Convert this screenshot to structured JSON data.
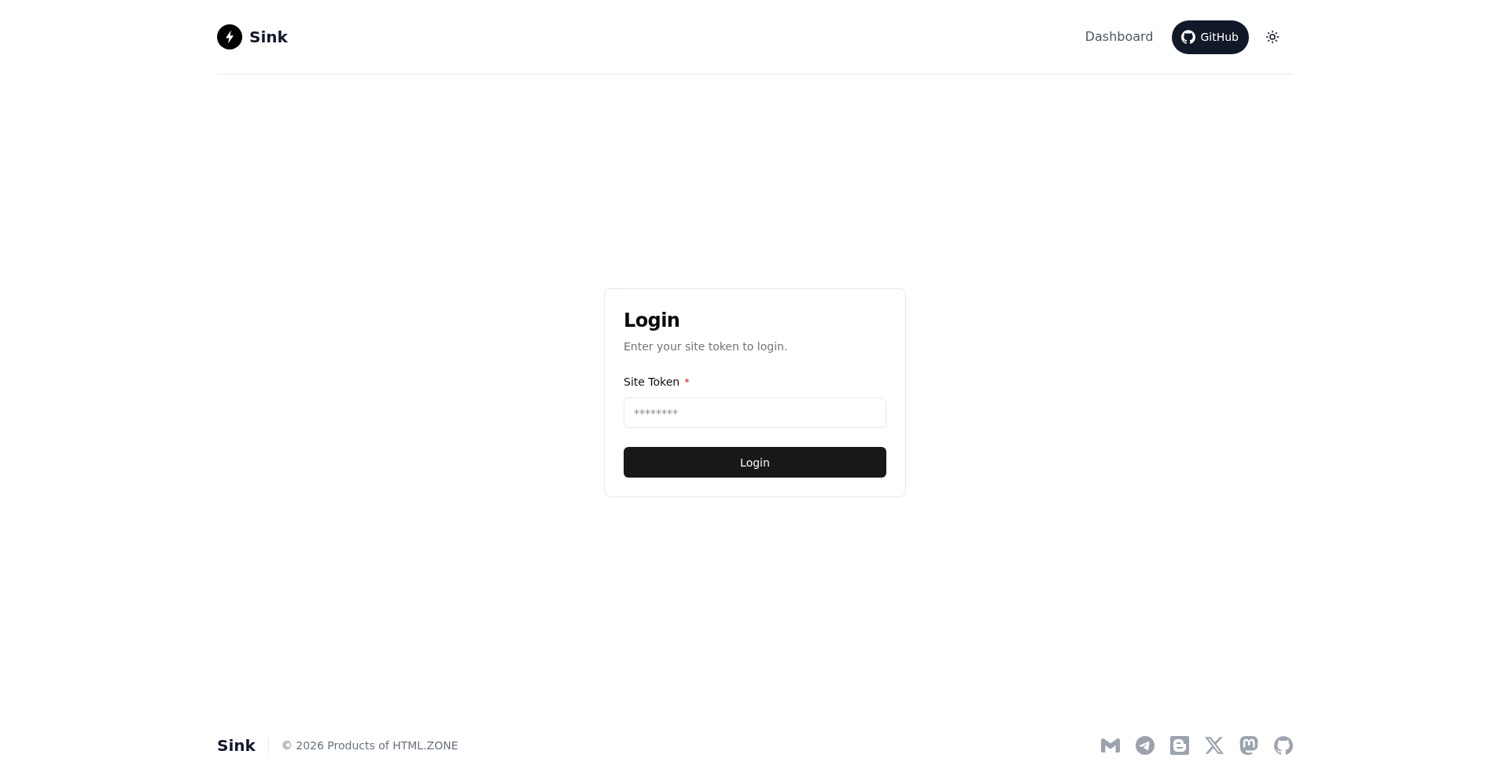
{
  "header": {
    "brand": "Sink",
    "nav_link": "Dashboard",
    "github_button": "GitHub"
  },
  "login_card": {
    "title": "Login",
    "description": "Enter your site token to login.",
    "field": {
      "label": "Site Token",
      "required": true,
      "placeholder": "********"
    },
    "submit_button": "Login"
  },
  "footer": {
    "brand": "Sink",
    "copyright": "© 2026 Products of HTML.ZONE"
  }
}
